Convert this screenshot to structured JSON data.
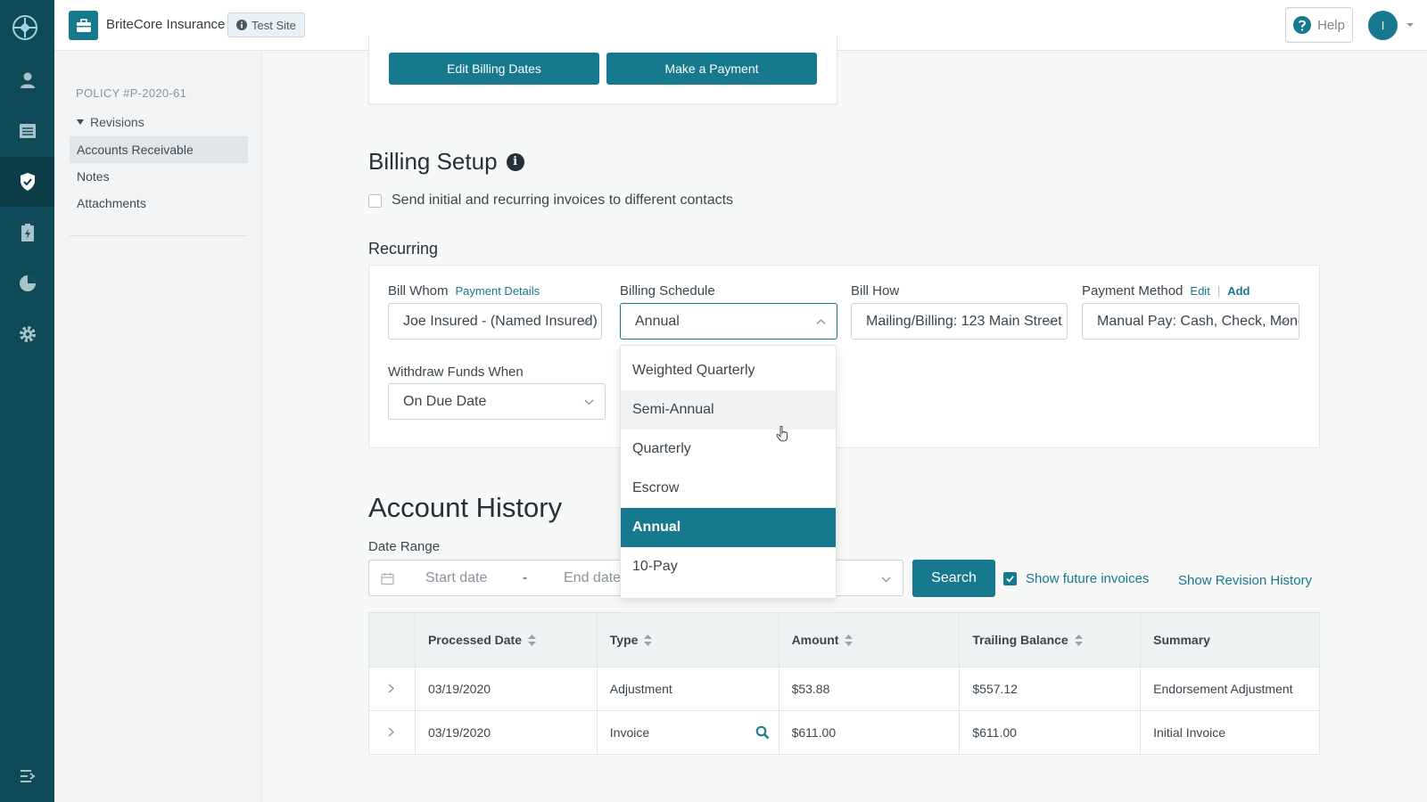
{
  "topbar": {
    "brand": "BriteCore Insurance",
    "site_badge": "Test Site",
    "help": "Help",
    "avatar_initial": "I"
  },
  "rail": {
    "icons": [
      "britecore-logo-icon",
      "person-icon",
      "list-icon",
      "shield-check-icon",
      "clipboard-bolt-icon",
      "pie-chart-icon",
      "gear-icon",
      "collapse-menu-icon"
    ],
    "active": "shield-check-icon"
  },
  "subnav": {
    "policy_number": "POLICY #P-2020-61",
    "revisions": "Revisions",
    "items": [
      {
        "label": "Accounts Receivable",
        "active": true
      },
      {
        "label": "Notes",
        "active": false
      },
      {
        "label": "Attachments",
        "active": false
      }
    ]
  },
  "actions": {
    "edit_billing_dates": "Edit Billing Dates",
    "make_payment": "Make a Payment"
  },
  "billing_setup": {
    "title": "Billing Setup",
    "info_glyph": "i",
    "different_contacts_label": "Send initial and recurring invoices to different contacts",
    "different_contacts_checked": false,
    "recurring_title": "Recurring",
    "bill_whom": {
      "label": "Bill Whom",
      "link": "Payment Details",
      "value": "Joe Insured - (Named Insured)"
    },
    "billing_schedule": {
      "label": "Billing Schedule",
      "value": "Annual"
    },
    "bill_how": {
      "label": "Bill How",
      "value": "Mailing/Billing: 123 Main Street"
    },
    "payment_method": {
      "label": "Payment Method",
      "edit": "Edit",
      "separator": "|",
      "add": "Add",
      "value": "Manual Pay: Cash, Check, Money Order"
    },
    "withdraw_funds": {
      "label": "Withdraw Funds When",
      "value": "On Due Date"
    }
  },
  "schedule_dropdown": {
    "options": [
      "Weighted Quarterly",
      "Semi-Annual",
      "Quarterly",
      "Escrow",
      "Annual",
      "10-Pay"
    ],
    "selected": "Annual",
    "hovered": "Semi-Annual"
  },
  "account_history": {
    "title": "Account History",
    "date_range_label": "Date Range",
    "start_placeholder": "Start date",
    "dash": "-",
    "end_placeholder": "End date",
    "search": "Search",
    "show_future": "Show future invoices",
    "show_future_checked": true,
    "show_revision_history": "Show Revision History",
    "columns": [
      "Processed Date",
      "Type",
      "Amount",
      "Trailing Balance",
      "Summary"
    ],
    "rows": [
      {
        "date": "03/19/2020",
        "type": "Adjustment",
        "amount": "$53.88",
        "balance": "$557.12",
        "summary": "Endorsement Adjustment"
      },
      {
        "date": "03/19/2020",
        "type": "Invoice",
        "amount": "$611.00",
        "balance": "$611.00",
        "summary": "Initial Invoice"
      }
    ]
  },
  "colors": {
    "accent": "#16798d",
    "rail": "#0f4a58"
  }
}
